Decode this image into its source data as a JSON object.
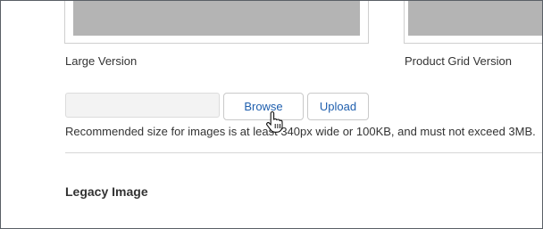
{
  "previews": {
    "large_caption": "Large Version",
    "grid_caption": "Product Grid Version"
  },
  "upload": {
    "file_value": "",
    "browse_label": "Browse",
    "upload_label": "Upload",
    "hint": "Recommended size for images is at least 340px wide or 100KB, and must not exceed 3MB."
  },
  "legacy": {
    "heading": "Legacy Image"
  },
  "icons": {
    "cursor": "hand-pointer-icon"
  },
  "colors": {
    "button_text": "#1f5fae",
    "image_placeholder": "#b4b4b4",
    "field_background": "#f3f3f3"
  }
}
